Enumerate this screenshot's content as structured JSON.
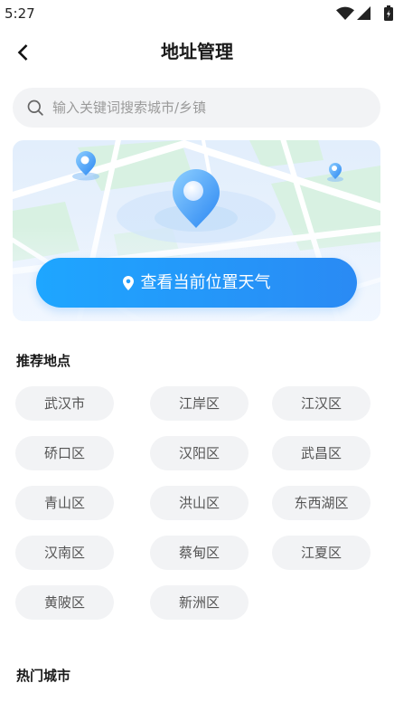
{
  "status_bar": {
    "time": "5:27",
    "icons": [
      "wifi-icon",
      "signal-icon",
      "battery-icon"
    ]
  },
  "header": {
    "title": "地址管理",
    "back_icon": "chevron-left-icon"
  },
  "search": {
    "placeholder": "输入关键词搜索城市/乡镇",
    "value": "",
    "icon": "search-icon"
  },
  "map": {
    "locate_button": {
      "label": "查看当前位置天气",
      "icon": "location-pin-icon"
    }
  },
  "recommended": {
    "title": "推荐地点",
    "places": [
      "武汉市",
      "江岸区",
      "江汉区",
      "硚口区",
      "汉阳区",
      "武昌区",
      "青山区",
      "洪山区",
      "东西湖区",
      "汉南区",
      "蔡甸区",
      "江夏区",
      "黄陂区",
      "新洲区"
    ]
  },
  "hot_cities": {
    "title": "热门城市"
  },
  "colors": {
    "accent": "#1EA6FF",
    "accent_end": "#2A8AF4",
    "chip_background": "#F2F3F5",
    "chip_text": "#555555",
    "search_background": "#F2F3F5",
    "placeholder": "#9A9A9A",
    "text_primary": "#1A1A1A"
  }
}
